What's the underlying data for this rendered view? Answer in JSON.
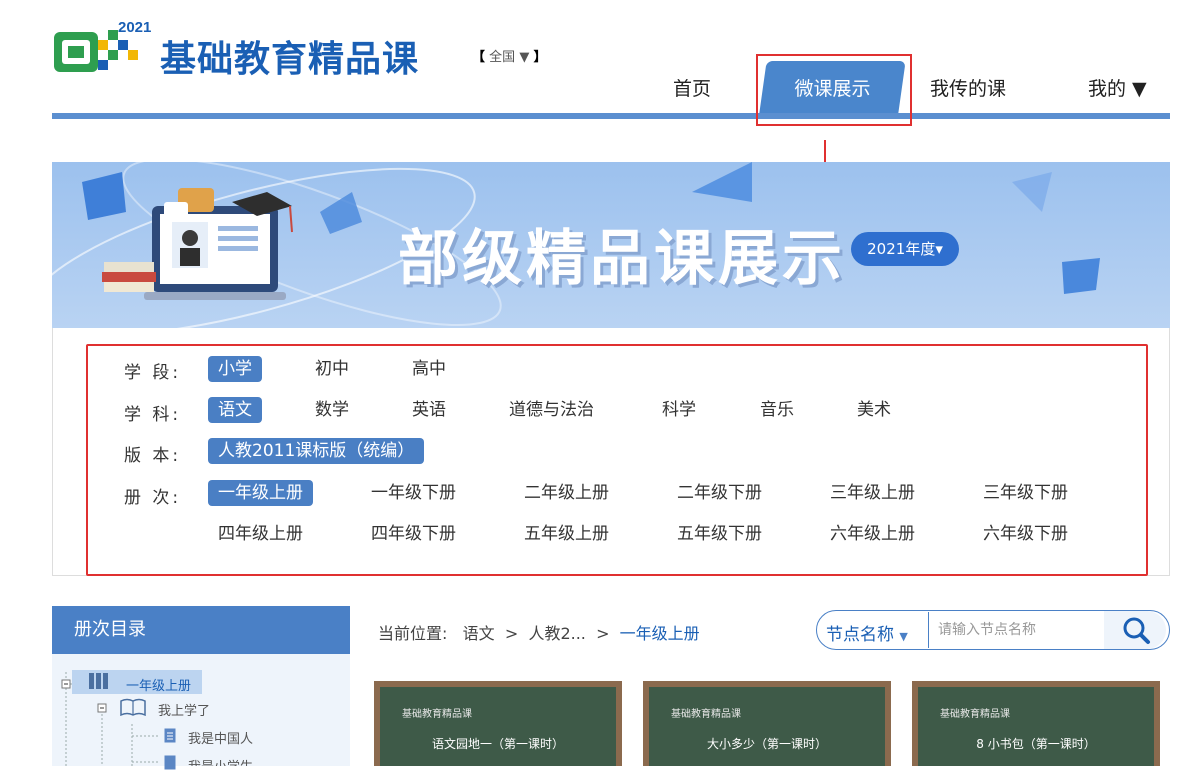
{
  "header": {
    "logo_year": "2021",
    "site_title": "基础教育精品课",
    "region_open": "【",
    "region": "全国",
    "region_arrow": "▼",
    "region_close": "】"
  },
  "nav": {
    "items": [
      "首页",
      "微课展示",
      "我传的课",
      "我的 ▼"
    ],
    "active": "微课展示"
  },
  "banner": {
    "title": "部级精品课展示",
    "year_selector": "2021年度",
    "year_arrow": "▾"
  },
  "filters": {
    "stage": {
      "label": "学 段:",
      "options": [
        "小学",
        "初中",
        "高中"
      ],
      "selected": "小学"
    },
    "subject": {
      "label": "学 科:",
      "options": [
        "语文",
        "数学",
        "英语",
        "道德与法治",
        "科学",
        "音乐",
        "美术"
      ],
      "selected": "语文"
    },
    "edition": {
      "label": "版 本:",
      "options": [
        "人教2011课标版（统编）"
      ],
      "selected": "人教2011课标版（统编）"
    },
    "volume": {
      "label": "册 次:",
      "options": [
        "一年级上册",
        "一年级下册",
        "二年级上册",
        "二年级下册",
        "三年级上册",
        "三年级下册",
        "四年级上册",
        "四年级下册",
        "五年级上册",
        "五年级下册",
        "六年级上册",
        "六年级下册"
      ],
      "selected": "一年级上册"
    }
  },
  "sidebar": {
    "title": "册次目录",
    "tree": [
      "一年级上册",
      "我上学了",
      "我是中国人",
      "我是小学生"
    ]
  },
  "breadcrumb": {
    "prefix": "当前位置:",
    "items": [
      "语文",
      "人教2...",
      "一年级上册"
    ],
    "separator": ">"
  },
  "search": {
    "type": "节点名称",
    "type_arrow": "▼",
    "placeholder": "请输入节点名称"
  },
  "cards": [
    {
      "brand": "基础教育精品课",
      "title": "语文园地一（第一课时）"
    },
    {
      "brand": "基础教育精品课",
      "title": "大小多少（第一课时）"
    },
    {
      "brand": "基础教育精品课",
      "title": "8 小书包（第一课时）"
    }
  ],
  "colors": {
    "accent": "#4a80c6",
    "brand": "#1a5fb4",
    "highlight_box": "#e03030"
  }
}
